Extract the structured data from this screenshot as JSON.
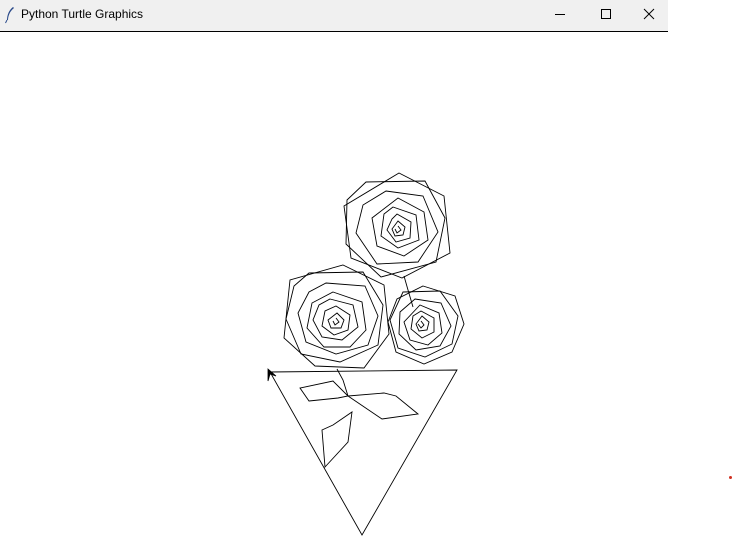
{
  "window": {
    "title": "Python Turtle Graphics",
    "icon": "feather-icon",
    "controls": {
      "minimize_icon": "minimize-icon",
      "maximize_icon": "maximize-icon",
      "close_icon": "close-icon"
    }
  },
  "canvas": {
    "background": "#ffffff",
    "stroke_color": "#000000",
    "drawing": "rose bouquet in a cone vase",
    "turtle_cursor": "arrow-turtle-icon"
  },
  "colors": {
    "titlebar_bg": "#f0f0f0",
    "dot": "#d03020"
  }
}
